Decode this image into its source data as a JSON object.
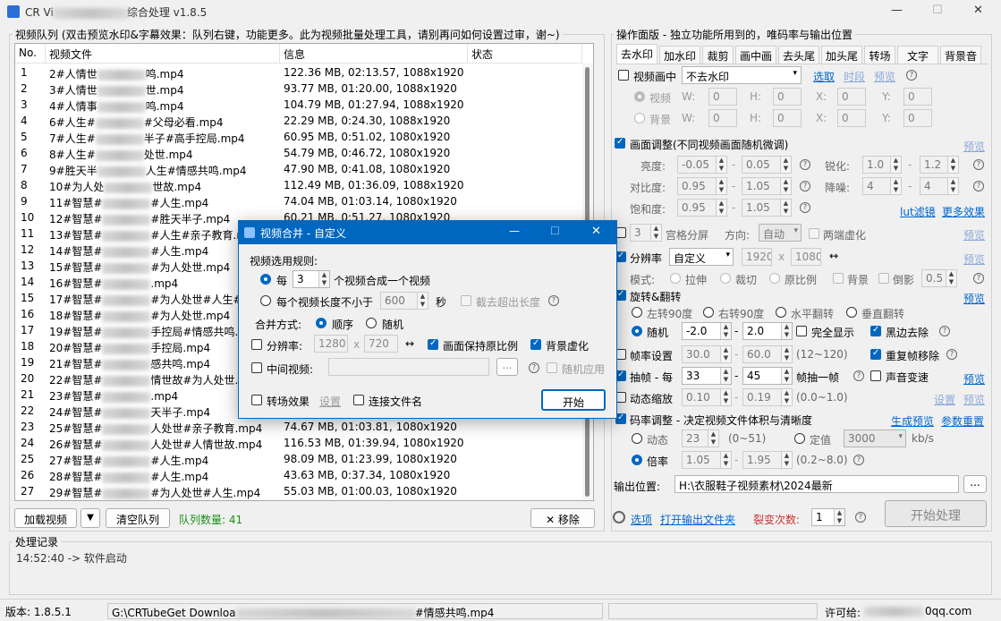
{
  "window": {
    "title_prefix": "CR Vi",
    "title_suffix": "综合处理 v1.8.5",
    "minimize": "—",
    "maximize": "☐",
    "close": "✕"
  },
  "queue": {
    "group_title": "视频队列 (双击预览水印&字幕效果：队列右键，功能更多。此为视频批量处理工具，请别再问如何设置过审，谢~)",
    "columns": {
      "no": "No.",
      "file": "视频文件",
      "info": "信息",
      "status": "状态"
    },
    "rows": [
      {
        "no": "1",
        "file": "2#人情世",
        "file_end": "鸣.mp4",
        "info": "122.36 MB, 02:13.57, 1088x1920"
      },
      {
        "no": "2",
        "file": "3#人情世",
        "file_end": "世.mp4",
        "info": "93.77 MB, 01:20.00, 1088x1920"
      },
      {
        "no": "3",
        "file": "4#人情事",
        "file_end": "鸣.mp4",
        "info": "104.79 MB, 01:27.94, 1088x1920"
      },
      {
        "no": "4",
        "file": "6#人生#",
        "file_end": "#父母必看.mp4",
        "info": "22.29 MB, 0:24.30, 1088x1920"
      },
      {
        "no": "5",
        "file": "7#人生#",
        "file_end": "半子#高手控局.mp4",
        "info": "60.95 MB, 0:51.02, 1080x1920"
      },
      {
        "no": "6",
        "file": "8#人生#",
        "file_end": "处世.mp4",
        "info": "54.79 MB, 0:46.72, 1080x1920"
      },
      {
        "no": "7",
        "file": "9#胜天半",
        "file_end": "人生#情感共鸣.mp4",
        "info": "47.90 MB, 0:41.08, 1080x1920"
      },
      {
        "no": "8",
        "file": "10#为人处",
        "file_end": "世故.mp4",
        "info": "112.49 MB, 01:36.09, 1088x1920"
      },
      {
        "no": "9",
        "file": "11#智慧#",
        "file_end": "#人生.mp4",
        "info": "74.04 MB, 01:03.14, 1080x1920"
      },
      {
        "no": "10",
        "file": "12#智慧#",
        "file_end": "#胜天半子.mp4",
        "info": "60.21 MB, 0:51.27, 1080x1920"
      },
      {
        "no": "11",
        "file": "13#智慧#",
        "file_end": "#人生#亲子教育.mp4",
        "info": ""
      },
      {
        "no": "12",
        "file": "14#智慧#",
        "file_end": "#人生.mp4",
        "info": ""
      },
      {
        "no": "13",
        "file": "15#智慧#",
        "file_end": "#为人处世.mp4",
        "info": ""
      },
      {
        "no": "14",
        "file": "16#智慧#",
        "file_end": ".mp4",
        "info": ""
      },
      {
        "no": "15",
        "file": "17#智慧#",
        "file_end": "#为人处世#人生#胜",
        "info": ""
      },
      {
        "no": "16",
        "file": "18#智慧#",
        "file_end": "#为人处世.mp4",
        "info": ""
      },
      {
        "no": "17",
        "file": "19#智慧#",
        "file_end": "手控局#情感共鸣.mp4",
        "info": ""
      },
      {
        "no": "18",
        "file": "20#智慧#",
        "file_end": "手控局.mp4",
        "info": ""
      },
      {
        "no": "19",
        "file": "21#智慧#",
        "file_end": "感共鸣.mp4",
        "info": ""
      },
      {
        "no": "20",
        "file": "22#智慧#",
        "file_end": "情世故#为人处世.mp4",
        "info": ""
      },
      {
        "no": "21",
        "file": "23#智慧#",
        "file_end": ".mp4",
        "info": ""
      },
      {
        "no": "22",
        "file": "24#智慧#",
        "file_end": "天半子.mp4",
        "info": ""
      },
      {
        "no": "23",
        "file": "25#智慧#",
        "file_end": "人处世#亲子教育.mp4",
        "info": "74.67 MB, 01:03.81, 1080x1920"
      },
      {
        "no": "24",
        "file": "26#智慧#",
        "file_end": "人处世#人情世故.mp4",
        "info": "116.53 MB, 01:39.94, 1080x1920"
      },
      {
        "no": "25",
        "file": "27#智慧#",
        "file_end": "#人生.mp4",
        "info": "98.09 MB, 01:23.99, 1080x1920"
      },
      {
        "no": "26",
        "file": "28#智慧#",
        "file_end": "#人生.mp4",
        "info": "43.63 MB, 0:37.34, 1080x1920"
      },
      {
        "no": "27",
        "file": "29#智慧#",
        "file_end": "#为人处世#人生.mp4",
        "info": "55.03 MB, 01:00.03, 1080x1920"
      }
    ],
    "add_button": "加载视频",
    "dropdown": "▼",
    "clear_button": "清空队列",
    "count_label": "队列数量: 41",
    "remove_button": "✕ 移除"
  },
  "log": {
    "title": "处理记录",
    "line": "14:52:40 -> 软件启动"
  },
  "ops": {
    "group_title": "操作面版 - 独立功能所用到的，唯码率与输出位置",
    "tabs": [
      "去水印",
      "加水印",
      "裁剪",
      "画中画",
      "去头尾",
      "加头尾",
      "转场",
      "文字",
      "背景音"
    ],
    "pip": {
      "label": "视频画中",
      "select": "不去水印",
      "pick": "选取",
      "period": "时段",
      "preview": "预览",
      "video_label": "视频",
      "bg_label": "背景",
      "w": "W:",
      "h": "H:",
      "x": "X:",
      "y": "Y:",
      "zero": "0"
    },
    "adjust": {
      "label": "画面调整(不同视频画面随机微调)",
      "preview": "预览",
      "brightness": "亮度:",
      "b1": "-0.05",
      "b2": "0.05",
      "sharpen": "锐化:",
      "s1": "1.0",
      "s2": "1.2",
      "contrast": "对比度:",
      "c1": "0.95",
      "c2": "1.05",
      "denoise": "降噪:",
      "d1": "4",
      "d2": "4",
      "saturation": "饱和度:",
      "sa1": "0.95",
      "sa2": "1.05",
      "lut": "lut滤镜",
      "more": "更多效果"
    },
    "grid": {
      "value": "3",
      "label": "宫格分屏",
      "dir_label": "方向:",
      "dir": "自动",
      "both": "两端虚化",
      "preview": "预览"
    },
    "res": {
      "label": "分辨率",
      "select": "自定义",
      "w": "1920",
      "x": "x",
      "h": "1080",
      "swap": "↔",
      "preview": "预览",
      "mode": "模式:",
      "m1": "拉伸",
      "m2": "裁切",
      "m3": "原比例",
      "bg": "背景",
      "tilt": "倒影",
      "tilt_val": "0.5"
    },
    "rotate": {
      "label": "旋转&翻转",
      "preview": "预览",
      "left": "左转90度",
      "right": "右转90度",
      "hflip": "水平翻转",
      "vflip": "垂直翻转",
      "random": "随机",
      "r1": "-2.0",
      "r2": "2.0",
      "full": "完全显示",
      "blackedge": "黑边去除"
    },
    "fps": {
      "label": "帧率设置",
      "f1": "30.0",
      "f2": "60.0",
      "range": "(12~120)",
      "dedup": "重复帧移除"
    },
    "extract": {
      "label": "抽帧 - 每",
      "e1": "33",
      "e2": "45",
      "unit": "帧抽一帧",
      "sound": "声音变速",
      "preview": "预览"
    },
    "zoom": {
      "label": "动态缩放",
      "z1": "0.10",
      "z2": "0.19",
      "range": "(0.0~1.0)",
      "settings": "设置",
      "preview": "预览"
    },
    "bitrate": {
      "label": "码率调整 - 决定视频文件体积与清晰度",
      "gen": "生成预览",
      "reset": "参数重置",
      "dynamic": "动态",
      "crf": "23",
      "crf_range": "(0~51)",
      "fixed": "定值",
      "fixed_val": "3000",
      "unit": "kb/s",
      "multiple": "倍率",
      "bm1": "1.05",
      "bm2": "1.95",
      "bm_range": "(0.2~8.0)"
    },
    "output": {
      "label": "输出位置:",
      "path": "H:\\衣服鞋子视频素材\\2024最新",
      "browse": "..."
    },
    "options": "选项",
    "open_dir": "打开输出文件夹",
    "split_label": "裂变次数:",
    "split": "1",
    "start": "开始处理"
  },
  "dialog": {
    "title": "视频合并 - 自定义",
    "rule_label": "视频选用规则:",
    "every": "每",
    "every_val": "3",
    "every_suffix": "个视频合成一个视频",
    "each_len": "每个视频长度不小于",
    "len_val": "600",
    "sec": "秒",
    "cut": "截去超出长度",
    "merge_label": "合并方式:",
    "seq": "顺序",
    "rand": "随机",
    "res_label": "分辨率:",
    "rw": "1280",
    "rx": "x",
    "rh": "720",
    "swap": "↔",
    "keep": "画面保持原比例",
    "bgblur": "背景虚化",
    "mid_label": "中间视频:",
    "mid_browse": "...",
    "rand_apply": "随机应用",
    "trans": "转场效果",
    "trans_set": "设置",
    "connect": "连接文件名",
    "start": "开始",
    "min": "—",
    "max": "☐",
    "close": "✕"
  },
  "status": {
    "version": "版本: 1.8.5.1",
    "path_start": "G:\\CRTubeGet Downloa",
    "path_end": "#情感共鸣.mp4",
    "license_label": "许可给:",
    "license_end": "0qq.com"
  },
  "colors": {
    "accent": "#0067c0",
    "link": "#0066cc",
    "count": "#1a8f1a",
    "split": "#cc3333"
  }
}
